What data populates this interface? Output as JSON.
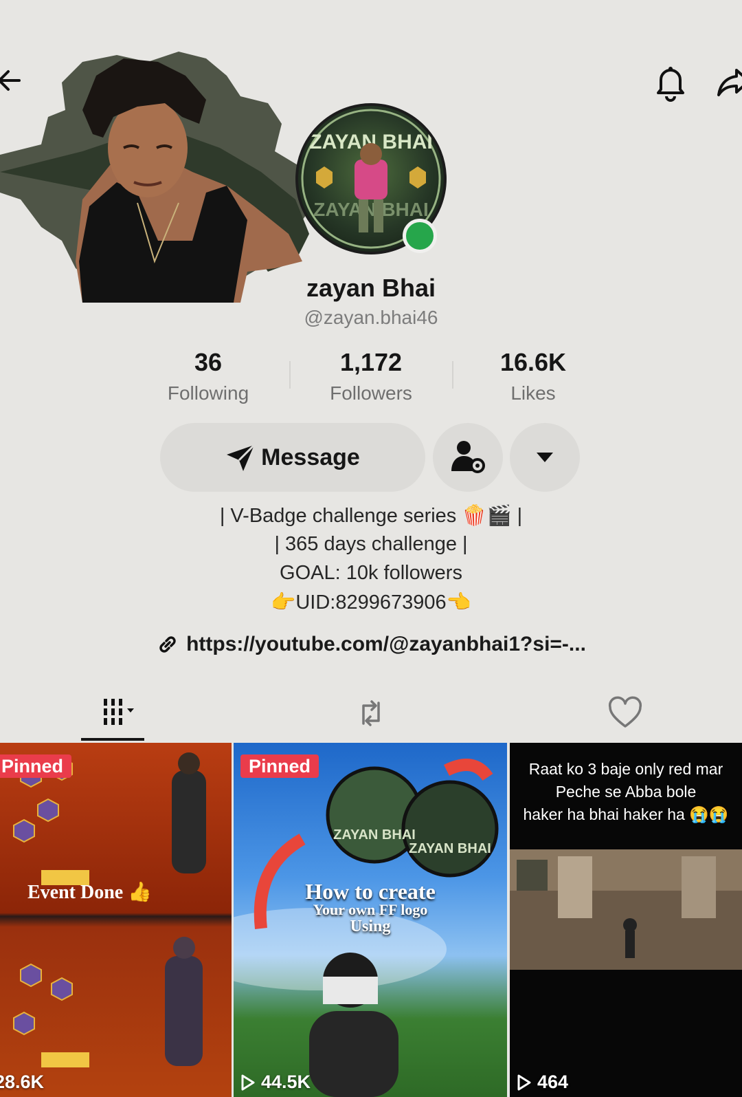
{
  "profile": {
    "name": "zayan Bhai",
    "handle": "@zayan.bhai46",
    "avatar_text": [
      "ZAYAN BHAI",
      "ZAYAN BHAI"
    ]
  },
  "stats": [
    {
      "value": "36",
      "label": "Following"
    },
    {
      "value": "1,172",
      "label": "Followers"
    },
    {
      "value": "16.6K",
      "label": "Likes"
    }
  ],
  "actions": {
    "message_label": "Message"
  },
  "bio": {
    "lines": [
      "| V-Badge challenge series 🍿🎬 |",
      "| 365 days challenge |",
      "GOAL: 10k followers",
      "👉UID:8299673906👈"
    ],
    "link": "https://youtube.com/@zayanbhai1?si=-..."
  },
  "tabs": [
    {
      "name": "videos",
      "icon": "grid-icon",
      "selected": true
    },
    {
      "name": "reposts",
      "icon": "repost-icon",
      "selected": false
    },
    {
      "name": "liked",
      "icon": "heart-icon",
      "selected": false
    }
  ],
  "videos": [
    {
      "pinned_label": "Pinned",
      "views": "28.6K",
      "caption": "Event Done 👍"
    },
    {
      "pinned_label": "Pinned",
      "views": "44.5K",
      "caption": [
        "How to create",
        "Your own FF logo",
        "Using"
      ],
      "logo_text": [
        "ZAYAN BHAI",
        "ZAYAN BHAI"
      ]
    },
    {
      "views": "464",
      "caption": [
        "Raat ko 3 baje only red mar",
        "Peche se Abba bole",
        "haker ha bhai haker ha 😭😭"
      ]
    }
  ],
  "colors": {
    "background": "#e7e6e3",
    "online": "#26a64b",
    "pinned_badge": "#ea3c4b"
  }
}
